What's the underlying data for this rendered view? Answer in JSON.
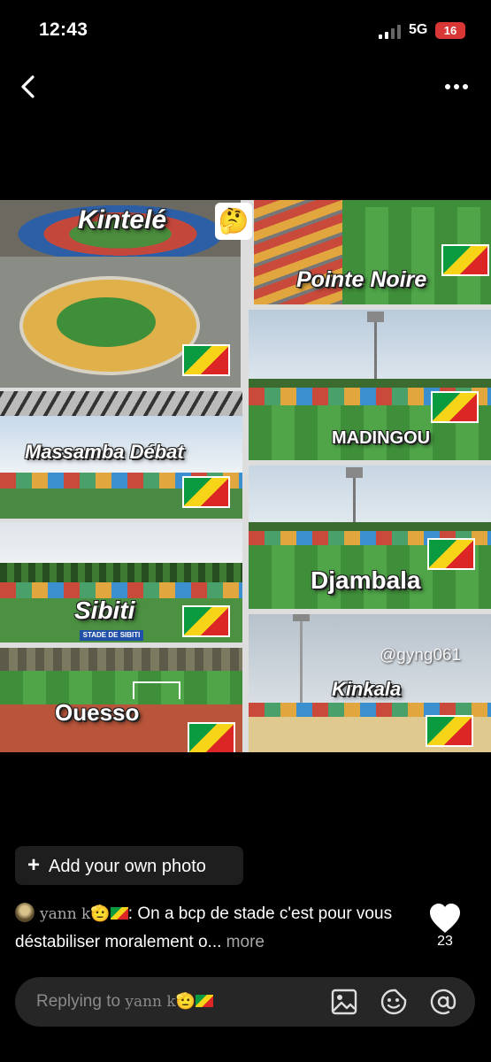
{
  "status_bar": {
    "time": "12:43",
    "network": "5G",
    "battery": "16"
  },
  "nav": {
    "back_icon": "chevron-left-icon",
    "more_icon": "more-horizontal-icon"
  },
  "post_image": {
    "emoji": "🤔",
    "watermark": "@gyng061",
    "tiles": [
      {
        "label": "Kintelé"
      },
      {
        "label": "Pointe Noire"
      },
      {
        "label": "Massamba Débat"
      },
      {
        "label": "MADINGOU"
      },
      {
        "label": "Sibiti",
        "sign": "STADE DE SIBITI"
      },
      {
        "label": "Djambala"
      },
      {
        "label": "Ouesso"
      },
      {
        "label": "Kinkala"
      }
    ],
    "flag_colors": {
      "green": "#0a9a3f",
      "yellow": "#f7d417",
      "red": "#dc2626"
    }
  },
  "add_photo": {
    "plus": "+",
    "label": "Add your own photo"
  },
  "caption": {
    "username": "yann k",
    "text": ": On a bcp de stade c'est pour vous déstabiliser moralement o...",
    "more": "more",
    "emoji": "🫡"
  },
  "like": {
    "icon": "heart-icon",
    "count": "23"
  },
  "reply": {
    "placeholder_prefix": "Replying to ",
    "placeholder_user": "yann k",
    "emoji": "🫡",
    "icons": [
      "image-icon",
      "sticker-icon",
      "at-icon"
    ]
  }
}
